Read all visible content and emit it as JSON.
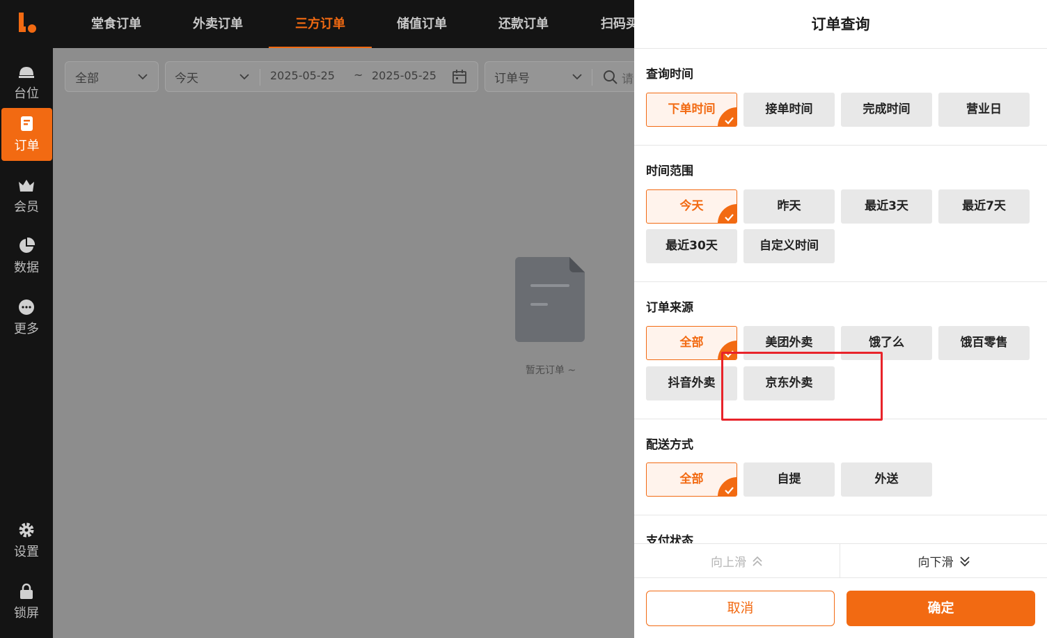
{
  "sidebar": {
    "items": [
      {
        "label": "台位",
        "icon": "table-bell-icon"
      },
      {
        "label": "订单",
        "icon": "order-icon",
        "active": true
      },
      {
        "label": "会员",
        "icon": "member-icon"
      },
      {
        "label": "数据",
        "icon": "pie-chart-icon"
      },
      {
        "label": "更多",
        "icon": "more-icon"
      },
      {
        "label": "设置",
        "icon": "gear-icon"
      },
      {
        "label": "锁屏",
        "icon": "lock-icon"
      }
    ]
  },
  "top_tabs": [
    "堂食订单",
    "外卖订单",
    "三方订单",
    "储值订单",
    "还款订单",
    "扫码买"
  ],
  "filters": {
    "status": "全部",
    "range": "今天",
    "start_date": "2025-05-25",
    "separator": "~",
    "end_date": "2025-05-25",
    "search_type": "订单号",
    "search_placeholder": "请"
  },
  "empty_text": "暂无订单 ~",
  "drawer": {
    "title": "订单查询",
    "sections": [
      {
        "title": "查询时间",
        "options": [
          "下单时间",
          "接单时间",
          "完成时间",
          "营业日"
        ],
        "selected": 0
      },
      {
        "title": "时间范围",
        "options": [
          "今天",
          "昨天",
          "最近3天",
          "最近7天",
          "最近30天",
          "自定义时间"
        ],
        "selected": 0
      },
      {
        "title": "订单来源",
        "options": [
          "全部",
          "美团外卖",
          "饿了么",
          "饿百零售",
          "抖音外卖",
          "京东外卖"
        ],
        "selected": 0
      },
      {
        "title": "配送方式",
        "options": [
          "全部",
          "自提",
          "外送"
        ],
        "selected": 0
      },
      {
        "title": "支付状态",
        "options": [],
        "selected": -1
      }
    ],
    "scroll_up": "向上滑",
    "scroll_down": "向下滑",
    "cancel": "取消",
    "confirm": "确定"
  },
  "colors": {
    "accent": "#f26a12",
    "highlight": "#e8232a"
  }
}
